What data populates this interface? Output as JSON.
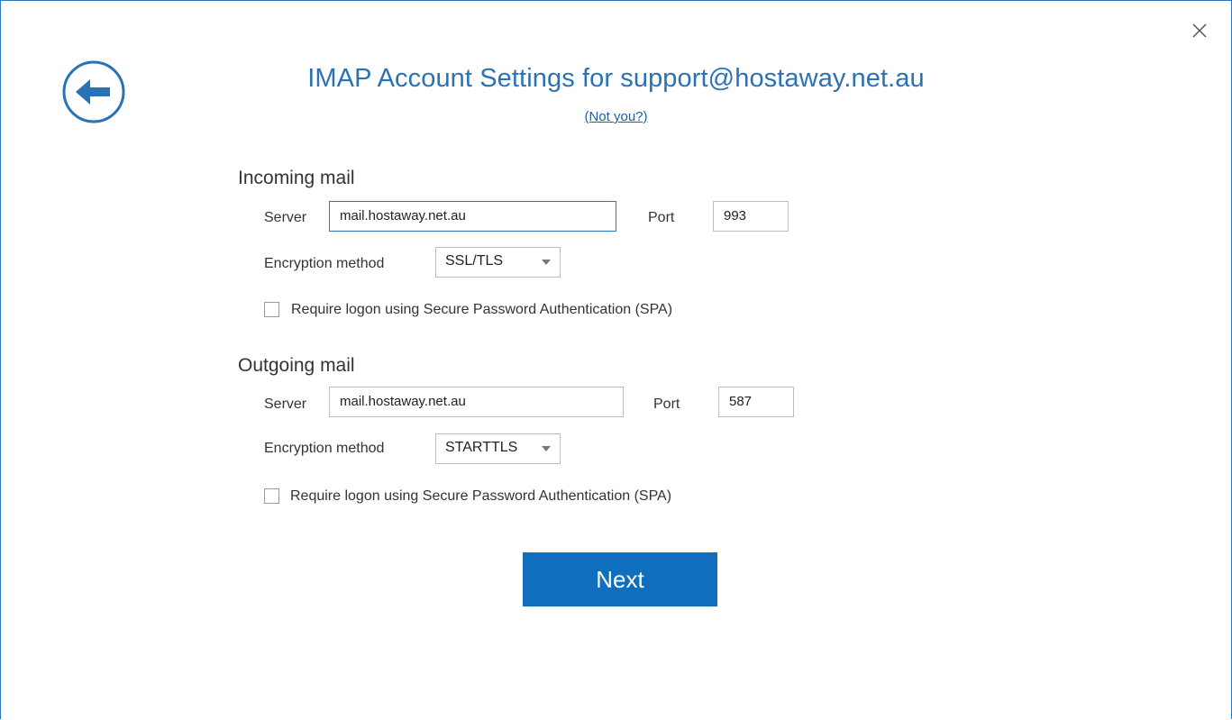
{
  "dialog": {
    "title": "IMAP Account Settings for support@hostaway.net.au",
    "not_you_link": "(Not you?)",
    "back_icon": "back-arrow-icon",
    "close_icon": "close-icon",
    "accent_color": "#2a72b5"
  },
  "incoming": {
    "heading": "Incoming mail",
    "server_label": "Server",
    "server_value": "mail.hostaway.net.au",
    "port_label": "Port",
    "port_value": "993",
    "encryption_label": "Encryption method",
    "encryption_value": "SSL/TLS",
    "spa_label": "Require logon using Secure Password Authentication (SPA)",
    "spa_checked": false
  },
  "outgoing": {
    "heading": "Outgoing mail",
    "server_label": "Server",
    "server_value": "mail.hostaway.net.au",
    "port_label": "Port",
    "port_value": "587",
    "encryption_label": "Encryption method",
    "encryption_value": "STARTTLS",
    "spa_label": "Require logon using Secure Password Authentication (SPA)",
    "spa_checked": false
  },
  "actions": {
    "next_label": "Next",
    "next_color": "#106ebe"
  }
}
